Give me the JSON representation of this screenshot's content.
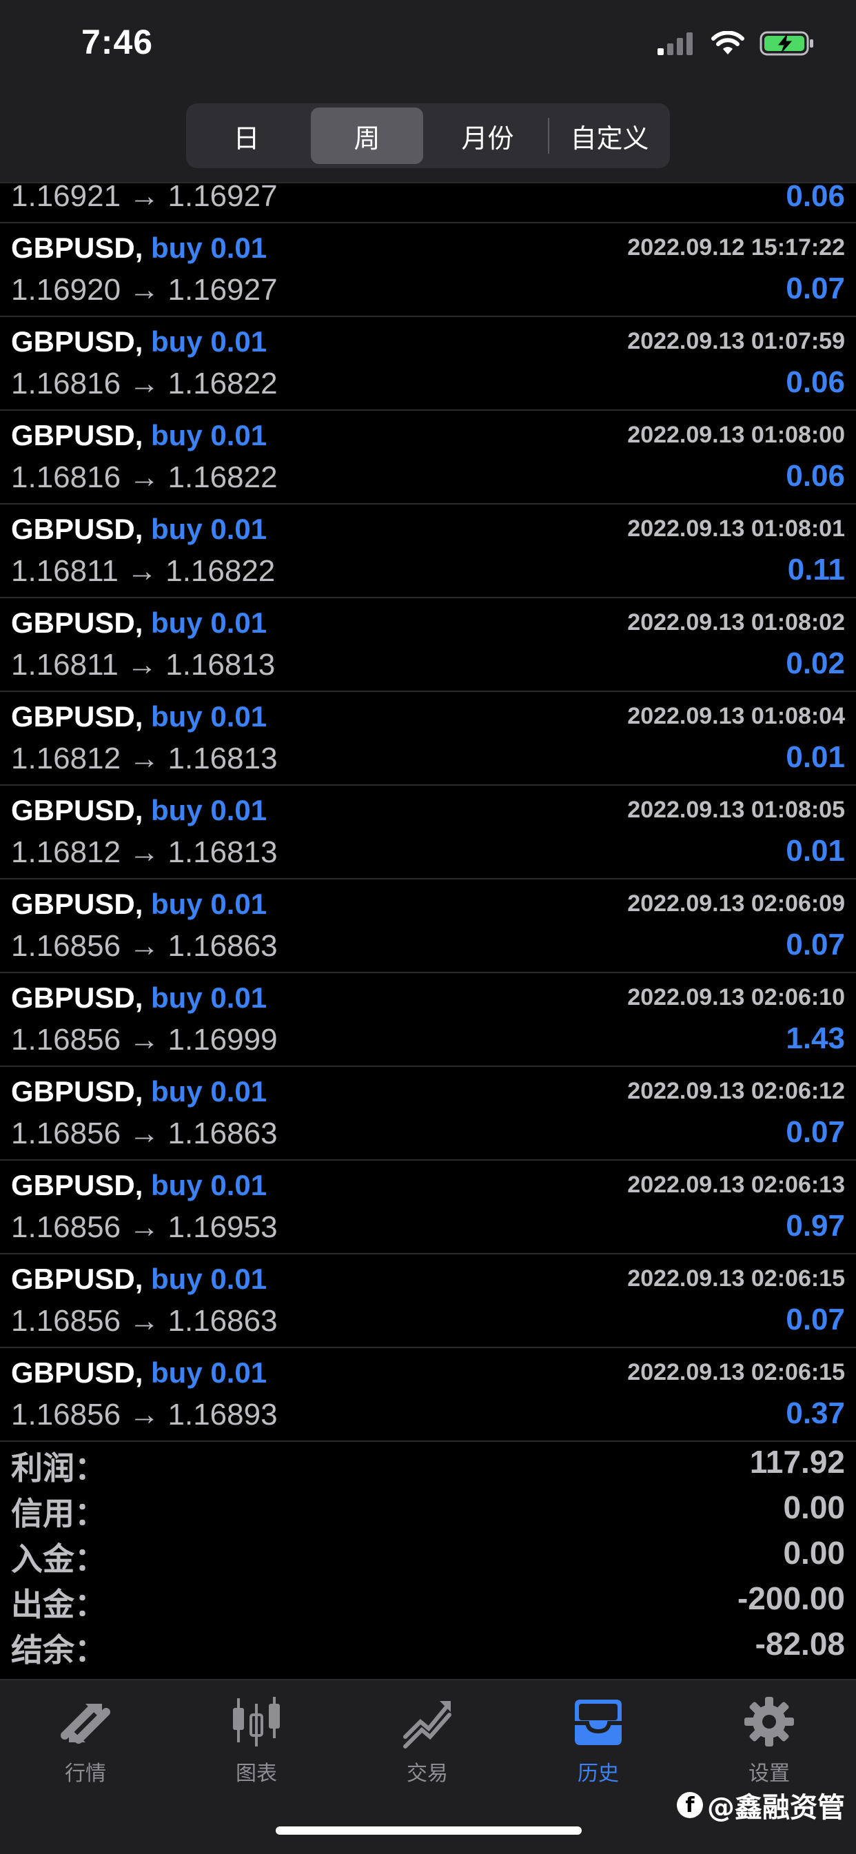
{
  "status_bar": {
    "time": "7:46"
  },
  "segments": [
    "日",
    "周",
    "月份",
    "自定义"
  ],
  "active_segment": 1,
  "partial_row": {
    "prices": "1.16921 → 1.16927",
    "profit": "0.06"
  },
  "trades": [
    {
      "symbol": "GBPUSD,",
      "type": "buy 0.01",
      "date": "2022.09.12 15:17:22",
      "prices": "1.16920 → 1.16927",
      "profit": "0.07"
    },
    {
      "symbol": "GBPUSD,",
      "type": "buy 0.01",
      "date": "2022.09.13 01:07:59",
      "prices": "1.16816 → 1.16822",
      "profit": "0.06"
    },
    {
      "symbol": "GBPUSD,",
      "type": "buy 0.01",
      "date": "2022.09.13 01:08:00",
      "prices": "1.16816 → 1.16822",
      "profit": "0.06"
    },
    {
      "symbol": "GBPUSD,",
      "type": "buy 0.01",
      "date": "2022.09.13 01:08:01",
      "prices": "1.16811 → 1.16822",
      "profit": "0.11"
    },
    {
      "symbol": "GBPUSD,",
      "type": "buy 0.01",
      "date": "2022.09.13 01:08:02",
      "prices": "1.16811 → 1.16813",
      "profit": "0.02"
    },
    {
      "symbol": "GBPUSD,",
      "type": "buy 0.01",
      "date": "2022.09.13 01:08:04",
      "prices": "1.16812 → 1.16813",
      "profit": "0.01"
    },
    {
      "symbol": "GBPUSD,",
      "type": "buy 0.01",
      "date": "2022.09.13 01:08:05",
      "prices": "1.16812 → 1.16813",
      "profit": "0.01"
    },
    {
      "symbol": "GBPUSD,",
      "type": "buy 0.01",
      "date": "2022.09.13 02:06:09",
      "prices": "1.16856 → 1.16863",
      "profit": "0.07"
    },
    {
      "symbol": "GBPUSD,",
      "type": "buy 0.01",
      "date": "2022.09.13 02:06:10",
      "prices": "1.16856 → 1.16999",
      "profit": "1.43"
    },
    {
      "symbol": "GBPUSD,",
      "type": "buy 0.01",
      "date": "2022.09.13 02:06:12",
      "prices": "1.16856 → 1.16863",
      "profit": "0.07"
    },
    {
      "symbol": "GBPUSD,",
      "type": "buy 0.01",
      "date": "2022.09.13 02:06:13",
      "prices": "1.16856 → 1.16953",
      "profit": "0.97"
    },
    {
      "symbol": "GBPUSD,",
      "type": "buy 0.01",
      "date": "2022.09.13 02:06:15",
      "prices": "1.16856 → 1.16863",
      "profit": "0.07"
    },
    {
      "symbol": "GBPUSD,",
      "type": "buy 0.01",
      "date": "2022.09.13 02:06:15",
      "prices": "1.16856 → 1.16893",
      "profit": "0.37"
    }
  ],
  "summary": [
    {
      "label": "利润：",
      "value": "117.92"
    },
    {
      "label": "信用：",
      "value": "0.00"
    },
    {
      "label": "入金：",
      "value": "0.00"
    },
    {
      "label": "出金：",
      "value": "-200.00"
    },
    {
      "label": "结余：",
      "value": "-82.08"
    }
  ],
  "tabs": [
    {
      "label": "行情",
      "icon": "quotes-arrows-icon"
    },
    {
      "label": "图表",
      "icon": "candlestick-chart-icon"
    },
    {
      "label": "交易",
      "icon": "trade-chart-icon"
    },
    {
      "label": "历史",
      "icon": "inbox-history-icon"
    },
    {
      "label": "设置",
      "icon": "gear-icon"
    }
  ],
  "active_tab": 3,
  "watermark": "@鑫融资管",
  "colors": {
    "accent": "#3d82f5",
    "muted_text": "#bdbdc2",
    "bar_bg": "#1f1f21"
  }
}
